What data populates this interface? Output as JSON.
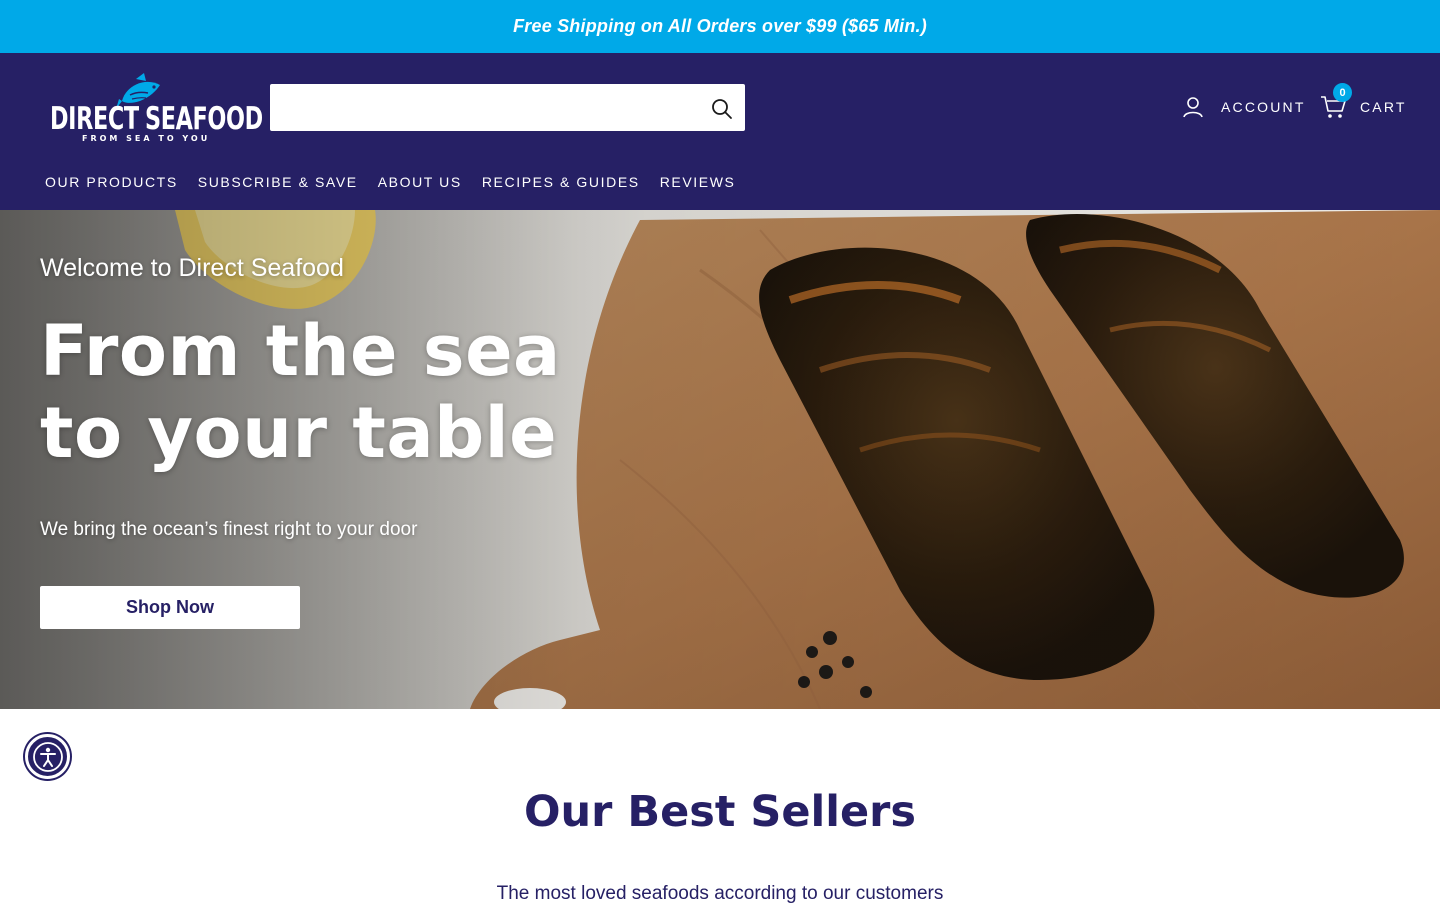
{
  "promo": {
    "text": "Free Shipping on All Orders over $99 ($65 Min.)"
  },
  "brand": {
    "logo_word_left": "DIRECT",
    "logo_word_right": "SEAFOOD",
    "logo_tagline": "FROM SEA TO YOU",
    "primary_color": "#262065",
    "accent_color": "#00a9e8"
  },
  "search": {
    "value": "",
    "placeholder": "",
    "icon": "search-icon"
  },
  "account": {
    "label": "ACCOUNT",
    "icon": "person-icon"
  },
  "cart": {
    "label": "CART",
    "count": "0",
    "icon": "cart-icon"
  },
  "nav": {
    "items": [
      {
        "label": "OUR PRODUCTS"
      },
      {
        "label": "SUBSCRIBE & SAVE"
      },
      {
        "label": "ABOUT US"
      },
      {
        "label": "RECIPES & GUIDES"
      },
      {
        "label": "REVIEWS"
      }
    ]
  },
  "hero": {
    "eyebrow": "Welcome to Direct Seafood",
    "title_line1": "From the sea",
    "title_line2": "to your table",
    "subtitle": "We bring the ocean’s finest right to your door",
    "cta_label": "Shop Now"
  },
  "accessibility": {
    "icon": "accessibility-icon"
  },
  "best_sellers": {
    "title": "Our Best Sellers",
    "subtitle": "The most loved seafoods according to our customers"
  }
}
